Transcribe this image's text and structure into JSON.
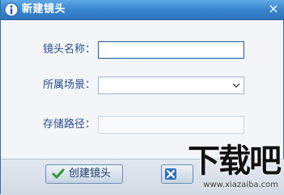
{
  "window": {
    "title": "新建镜头",
    "close_symbol": "×"
  },
  "form": {
    "name_label": "镜头名称：",
    "name_value": "",
    "scene_label": "所属场景：",
    "scene_value": "",
    "path_label": "存储路径：",
    "path_value": ""
  },
  "buttons": {
    "create_label": "创建镜头"
  },
  "watermark": {
    "logo_text": "下载吧",
    "url": "www.xiazaiba.com"
  },
  "colors": {
    "titlebar": "#3a86cf",
    "label_text": "#2a4f8a",
    "check_green": "#2e9b2e",
    "partial_button_blue": "#2f6fbf"
  }
}
